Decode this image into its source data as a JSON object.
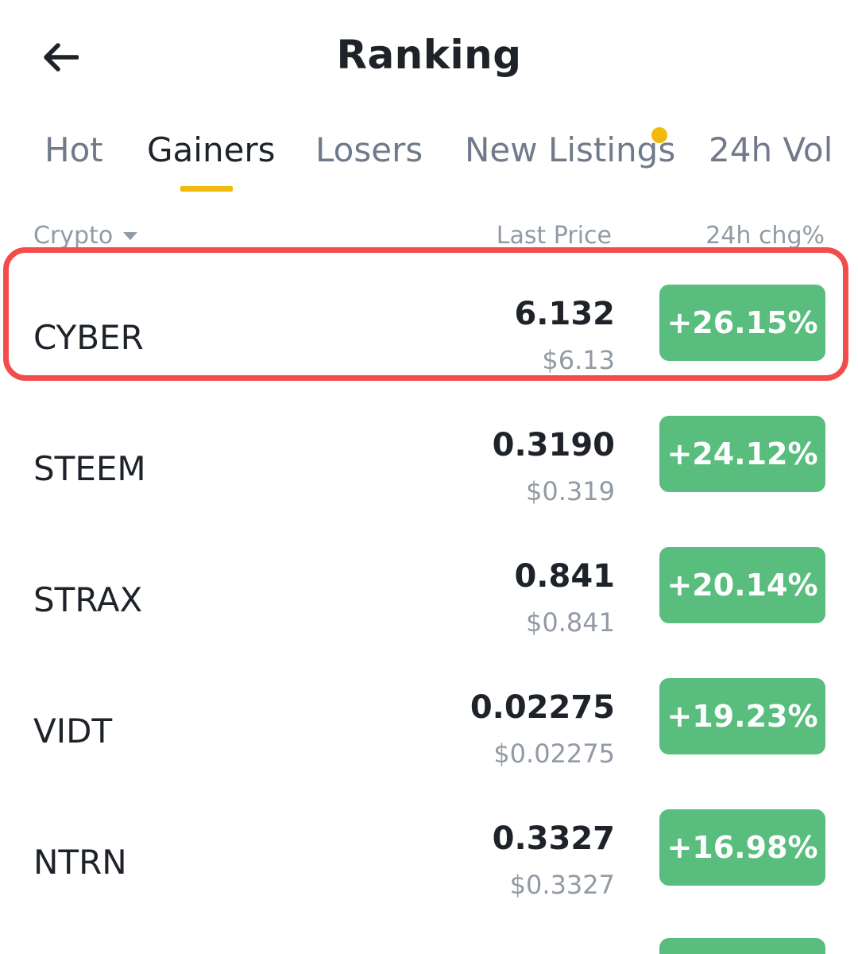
{
  "header": {
    "title": "Ranking",
    "back_icon": "arrow-left-icon"
  },
  "tabs": [
    {
      "label": "Hot",
      "active": false
    },
    {
      "label": "Gainers",
      "active": true
    },
    {
      "label": "Losers",
      "active": false
    },
    {
      "label": "New Listings",
      "active": false,
      "has_dot": true
    },
    {
      "label": "24h Vol",
      "active": false
    }
  ],
  "columns": {
    "crypto": "Crypto",
    "last_price": "Last Price",
    "change": "24h chg%",
    "sort_icon": "caret-down-icon"
  },
  "rows": [
    {
      "symbol": "CYBER",
      "price": "6.132",
      "usd": "$6.13",
      "change": "+26.15%"
    },
    {
      "symbol": "STEEM",
      "price": "0.3190",
      "usd": "$0.319",
      "change": "+24.12%"
    },
    {
      "symbol": "STRAX",
      "price": "0.841",
      "usd": "$0.841",
      "change": "+20.14%"
    },
    {
      "symbol": "VIDT",
      "price": "0.02275",
      "usd": "$0.02275",
      "change": "+19.23%"
    },
    {
      "symbol": "NTRN",
      "price": "0.3327",
      "usd": "$0.3327",
      "change": "+16.98%"
    }
  ],
  "colors": {
    "accent": "#f0b90b",
    "gain": "#58bd7d",
    "highlight": "#f44b4b",
    "text_primary": "#1e2329",
    "text_secondary": "#707a8a"
  }
}
